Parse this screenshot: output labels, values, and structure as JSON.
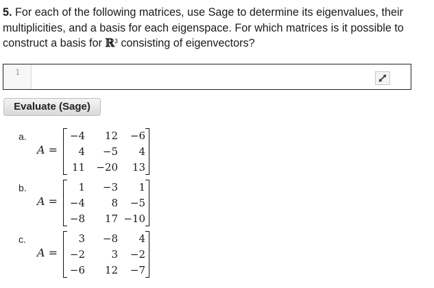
{
  "problem": {
    "number": "5.",
    "text_before": " For each of the following matrices, use Sage to determine its eigenvalues, their multiplicities, and a basis for each eigenspace. For which matrices is it possible to construct a basis for ",
    "field_symbol": "ℝ",
    "field_exponent": "3",
    "text_after": " consisting of eigenvectors?"
  },
  "code_cell": {
    "line_number": "1",
    "content": "",
    "expand_icon": "expand-arrows-icon"
  },
  "evaluate_button": {
    "label": "Evaluate (Sage)"
  },
  "matrices": [
    {
      "label": "a.",
      "lhs": "A",
      "eq": "=",
      "rows": [
        [
          "−4",
          "12",
          "−6"
        ],
        [
          "4",
          "−5",
          "4"
        ],
        [
          "11",
          "−20",
          "13"
        ]
      ]
    },
    {
      "label": "b.",
      "lhs": "A",
      "eq": "=",
      "rows": [
        [
          "1",
          "−3",
          "1"
        ],
        [
          "−4",
          "8",
          "−5"
        ],
        [
          "−8",
          "17",
          "−10"
        ]
      ]
    },
    {
      "label": "c.",
      "lhs": "A",
      "eq": "=",
      "rows": [
        [
          "3",
          "−8",
          "4"
        ],
        [
          "−2",
          "3",
          "−2"
        ],
        [
          "−6",
          "12",
          "−7"
        ]
      ]
    }
  ]
}
